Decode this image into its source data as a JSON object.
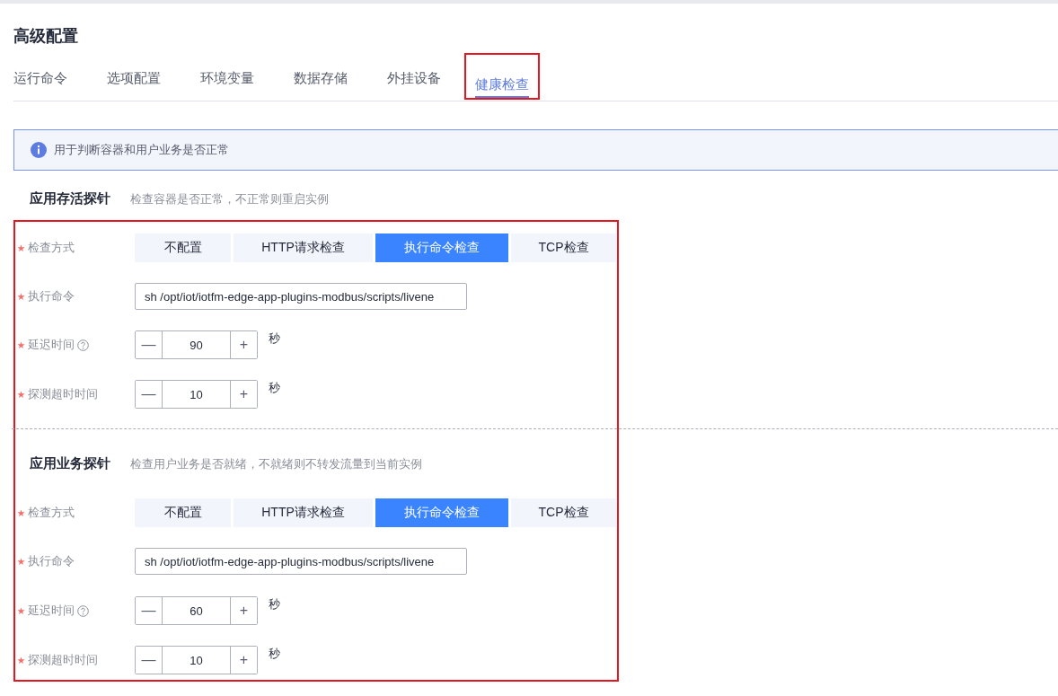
{
  "title": "高级配置",
  "tabs": [
    {
      "label": "运行命令",
      "selected": false,
      "highlighted": false
    },
    {
      "label": "选项配置",
      "selected": false,
      "highlighted": false
    },
    {
      "label": "环境变量",
      "selected": false,
      "highlighted": false
    },
    {
      "label": "数据存储",
      "selected": false,
      "highlighted": false
    },
    {
      "label": "外挂设备",
      "selected": false,
      "highlighted": false
    },
    {
      "label": "健康检查",
      "selected": true,
      "highlighted": true
    }
  ],
  "info": {
    "text": "用于判断容器和用户业务是否正常"
  },
  "probes_highlighted": true,
  "probes": [
    {
      "title": "应用存活探针",
      "description": "检查容器是否正常，不正常则重启实例",
      "fields": [
        {
          "kind": "segmented",
          "label": "检查方式",
          "required": true,
          "options": [
            {
              "label": "不配置",
              "selected": false
            },
            {
              "label": "HTTP请求检查",
              "selected": false
            },
            {
              "label": "执行命令检查",
              "selected": true
            },
            {
              "label": "TCP检查",
              "selected": false
            }
          ]
        },
        {
          "kind": "text",
          "label": "执行命令",
          "required": true,
          "value": "sh /opt/iot/iotfm-edge-app-plugins-modbus/scripts/livene"
        },
        {
          "kind": "stepper",
          "label": "延迟时间",
          "required": true,
          "help": true,
          "minus": "—",
          "value": "90",
          "plus": "+",
          "unit": "秒"
        },
        {
          "kind": "stepper",
          "label": "探测超时时间",
          "required": true,
          "help": false,
          "minus": "—",
          "value": "10",
          "plus": "+",
          "unit": "秒"
        }
      ]
    },
    {
      "title": "应用业务探针",
      "description": "检查用户业务是否就绪，不就绪则不转发流量到当前实例",
      "fields": [
        {
          "kind": "segmented",
          "label": "检查方式",
          "required": true,
          "options": [
            {
              "label": "不配置",
              "selected": false
            },
            {
              "label": "HTTP请求检查",
              "selected": false
            },
            {
              "label": "执行命令检查",
              "selected": true
            },
            {
              "label": "TCP检查",
              "selected": false
            }
          ]
        },
        {
          "kind": "text",
          "label": "执行命令",
          "required": true,
          "value": "sh /opt/iot/iotfm-edge-app-plugins-modbus/scripts/livene"
        },
        {
          "kind": "stepper",
          "label": "延迟时间",
          "required": true,
          "help": true,
          "minus": "—",
          "value": "60",
          "plus": "+",
          "unit": "秒"
        },
        {
          "kind": "stepper",
          "label": "探测超时时间",
          "required": true,
          "help": false,
          "minus": "—",
          "value": "10",
          "plus": "+",
          "unit": "秒"
        }
      ]
    }
  ]
}
